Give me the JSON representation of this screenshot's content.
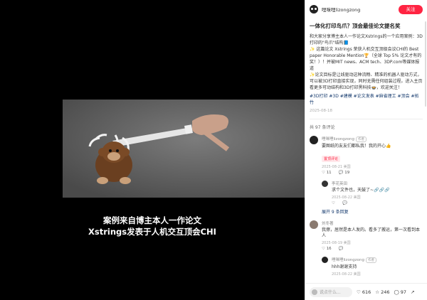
{
  "caption": {
    "line1": "案例来自博主本人一作论文",
    "line2": "Xstrings发表于人机交互顶会CHI"
  },
  "author": {
    "name": "哩咪哩lizongzong",
    "follow": "关注"
  },
  "note": {
    "title": "一体化打印鸟爪？顶会最佳论文提名奖",
    "body": "和大家分享博主本人一作论文Xstrings的一个应用案例：3D打印的\"鸟爪\"结构📘\n✨ 这篇论文 Xstrings 荣获人机交互顶级会议CHI的 Best paper Honorable Mention🏆（全球 Top 5% 论文才有的奖！）！并被MIT news、ACM tech、3DP.com等媒体报道\n✨论文目标是让线驱动这种流畅、精准的机器人驱动方式，可以被3D打印直接实现，同时无需任何组装过程。进入主页看更多可动结构和3D打印黑科技🍲，欢迎关注！",
    "tags": "#3D打印 #3D #建模 #论文发表 #麻省理工 #顶会 #拓竹",
    "date": "2025-08-18"
  },
  "comments_count": "共 97 条评论",
  "comments": [
    {
      "user": "哩咪哩lizongzong",
      "badge": "作者",
      "text": "要图纸的友友们都私我！我的开心👍",
      "pinned": "置顶评论",
      "date": "2025-08-21 美国",
      "likes": "11",
      "replies": "19",
      "avatar_color": "#222222",
      "sub": [
        {
          "user": "李花英田",
          "text": "求个文件也，天鼓了~🔗🔗🔗",
          "date": "2025-08-22 美国",
          "likes": "",
          "replies": "",
          "avatar_color": "#333333"
        }
      ],
      "expand": "展开 9 条回复"
    },
    {
      "user": "刘冬著",
      "text": "我擦，居然是本人发的。看多了搬运，第一次看到本人",
      "date": "2025-08-19 美国",
      "likes": "16",
      "replies": "",
      "avatar_color": "#8a7a70"
    },
    {
      "user": "哩咪哩lizongzong",
      "badge": "作者",
      "text": "hhh谢谢支持",
      "date": "2025-08-22 美国",
      "likes": "",
      "replies": "",
      "avatar_color": "#222222",
      "is_sub": true
    }
  ],
  "footer": {
    "placeholder": "说点什么...",
    "likes": "616",
    "stars": "246",
    "comments": "97"
  }
}
